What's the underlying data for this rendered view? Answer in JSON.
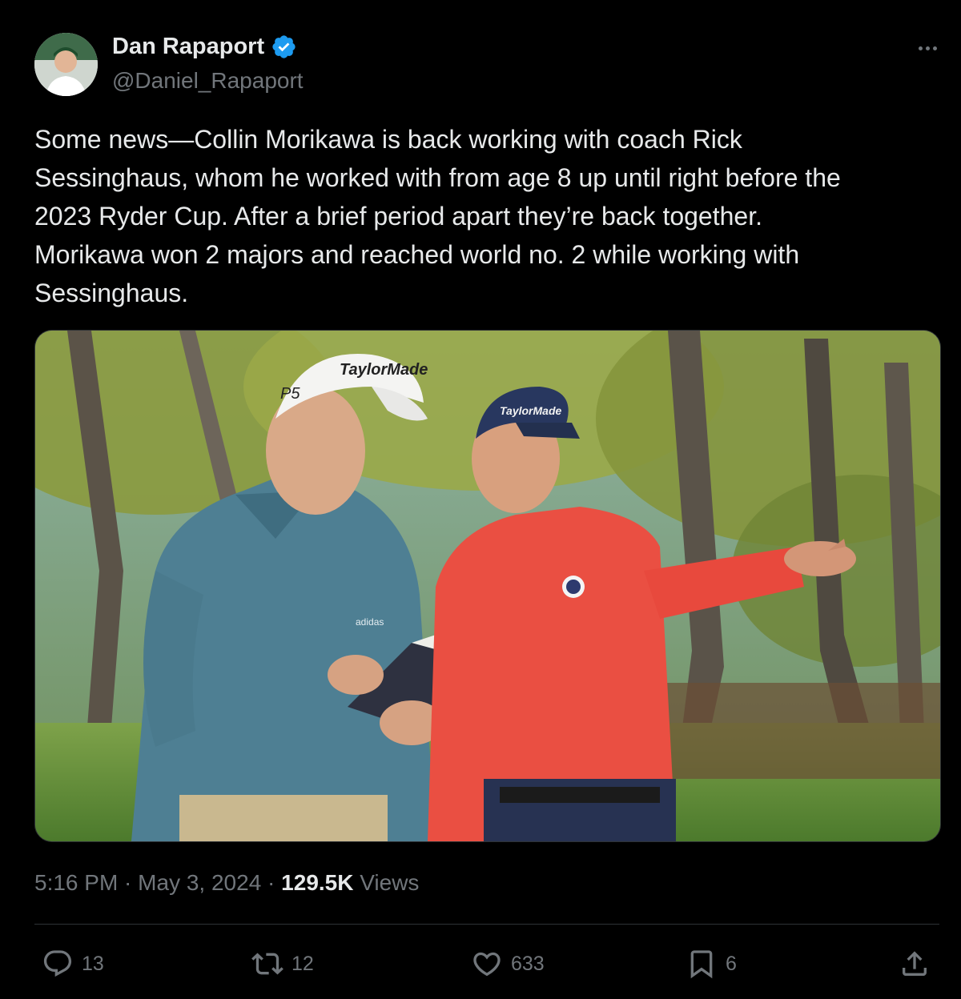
{
  "author": {
    "name": "Dan Rapaport",
    "handle": "@Daniel_Rapaport",
    "verified_color": "#1d9bf0"
  },
  "tweet": {
    "text_lines": [
      "Some news—Collin Morikawa is back working with coach Rick",
      "Sessinghaus, whom he worked with from age 8 up until right before the",
      "2023 Ryder Cup. After a brief period apart they’re back together.",
      "Morikawa won 2 majors and reached world no. 2 while working with",
      "Sessinghaus."
    ],
    "media": {
      "cap_left_text": "TaylorMade",
      "cap_left_side": "P5",
      "cap_right_text": "TaylorMade",
      "shirt_brand": "adidas"
    }
  },
  "meta": {
    "time": "5:16 PM",
    "separator": " · ",
    "date": "May 3, 2024",
    "views_count": "129.5K",
    "views_label": "Views"
  },
  "actions": {
    "reply_count": "13",
    "retweet_count": "12",
    "like_count": "633",
    "bookmark_count": "6"
  },
  "icons": [
    "more-icon",
    "verified-icon",
    "reply-icon",
    "retweet-icon",
    "like-icon",
    "bookmark-icon",
    "share-icon"
  ],
  "colors": {
    "background": "#000000",
    "text": "#e7e9ea",
    "secondary": "#71767b",
    "border": "#2f3336"
  }
}
